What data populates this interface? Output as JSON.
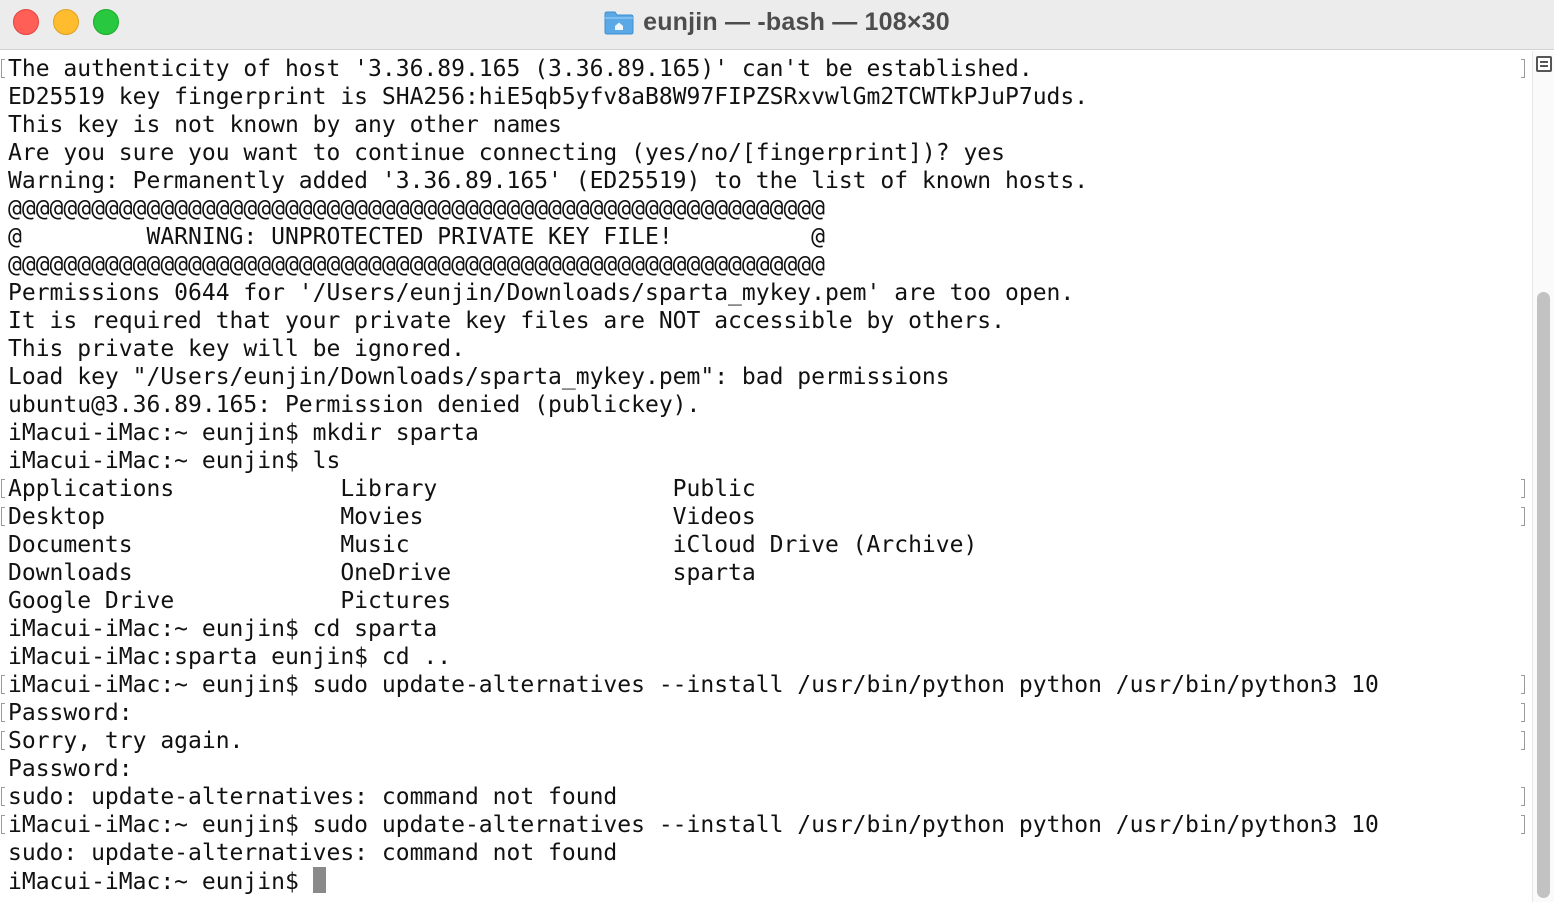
{
  "window": {
    "title": "eunjin — -bash — 108×30",
    "title_icon": "home-folder-icon"
  },
  "terminal": {
    "lines": [
      "The authenticity of host '3.36.89.165 (3.36.89.165)' can't be established.",
      "ED25519 key fingerprint is SHA256:hiE5qb5yfv8aB8W97FIPZSRxvwlGm2TCWTkPJuP7uds.",
      "This key is not known by any other names",
      "Are you sure you want to continue connecting (yes/no/[fingerprint])? yes",
      "Warning: Permanently added '3.36.89.165' (ED25519) to the list of known hosts.",
      "@@@@@@@@@@@@@@@@@@@@@@@@@@@@@@@@@@@@@@@@@@@@@@@@@@@@@@@@@@@",
      "@         WARNING: UNPROTECTED PRIVATE KEY FILE!          @",
      "@@@@@@@@@@@@@@@@@@@@@@@@@@@@@@@@@@@@@@@@@@@@@@@@@@@@@@@@@@@",
      "Permissions 0644 for '/Users/eunjin/Downloads/sparta_mykey.pem' are too open.",
      "It is required that your private key files are NOT accessible by others.",
      "This private key will be ignored.",
      "Load key \"/Users/eunjin/Downloads/sparta_mykey.pem\": bad permissions",
      "ubuntu@3.36.89.165: Permission denied (publickey).",
      "iMacui-iMac:~ eunjin$ mkdir sparta",
      "iMacui-iMac:~ eunjin$ ls",
      "Applications            Library                 Public",
      "Desktop                 Movies                  Videos",
      "Documents               Music                   iCloud Drive (Archive)",
      "Downloads               OneDrive                sparta",
      "Google Drive            Pictures",
      "iMacui-iMac:~ eunjin$ cd sparta",
      "iMacui-iMac:sparta eunjin$ cd ..",
      "iMacui-iMac:~ eunjin$ sudo update-alternatives --install /usr/bin/python python /usr/bin/python3 10",
      "Password:",
      "Sorry, try again.",
      "Password:",
      "sudo: update-alternatives: command not found",
      "iMacui-iMac:~ eunjin$ sudo update-alternatives --install /usr/bin/python python /usr/bin/python3 10",
      "sudo: update-alternatives: command not found"
    ],
    "prompt": "iMacui-iMac:~ eunjin$ "
  },
  "colors": {
    "close": "#ff5f57",
    "minimize": "#febc2e",
    "zoom": "#28c840",
    "text": "#111111",
    "titlebar": "#ececec",
    "folder": "#5aa9e6"
  }
}
